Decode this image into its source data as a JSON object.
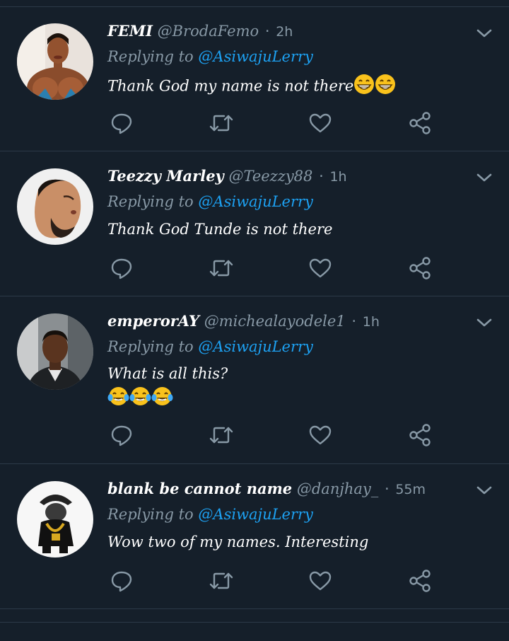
{
  "tweets": [
    {
      "name": "FEMI",
      "handle": "@BrodaFemo",
      "dot": "·",
      "time": "2h",
      "reply_label": "Replying to",
      "reply_mention": "@AsiwajuLerry",
      "text": "Thank God my name is not there",
      "trailing_emoji": "grinning-face-with-smiling-eyes x2",
      "avatar": "woman-portrait-avatar"
    },
    {
      "name": "Teezzy Marley",
      "handle": "@Teezzy88",
      "dot": "·",
      "time": "1h",
      "reply_label": "Replying to",
      "reply_mention": "@AsiwajuLerry",
      "text": "Thank God Tunde is not there",
      "avatar": "man-profile-avatar"
    },
    {
      "name": "emperorAY",
      "handle": "@michealayodele1",
      "dot": "·",
      "time": "1h",
      "reply_label": "Replying to",
      "reply_mention": "@AsiwajuLerry",
      "text": "What is all this?",
      "emoji_line": "face-with-tears-of-joy x3",
      "avatar": "man-selfie-avatar"
    },
    {
      "name": "blank be cannot name",
      "handle": "@danjhay_",
      "dot": "·",
      "time": "55m",
      "reply_label": "Replying to",
      "reply_mention": "@AsiwajuLerry",
      "text": "Wow two of my names. Interesting",
      "avatar": "cartoon-character-avatar"
    }
  ],
  "colors": {
    "background": "#151f2a",
    "divider": "#2c3a48",
    "muted": "#8899a6",
    "link": "#1da1f2",
    "text": "#ffffff"
  },
  "icons": {
    "reply": "reply-icon",
    "retweet": "retweet-icon",
    "like": "heart-icon",
    "share": "share-icon",
    "menu": "chevron-down-icon"
  }
}
